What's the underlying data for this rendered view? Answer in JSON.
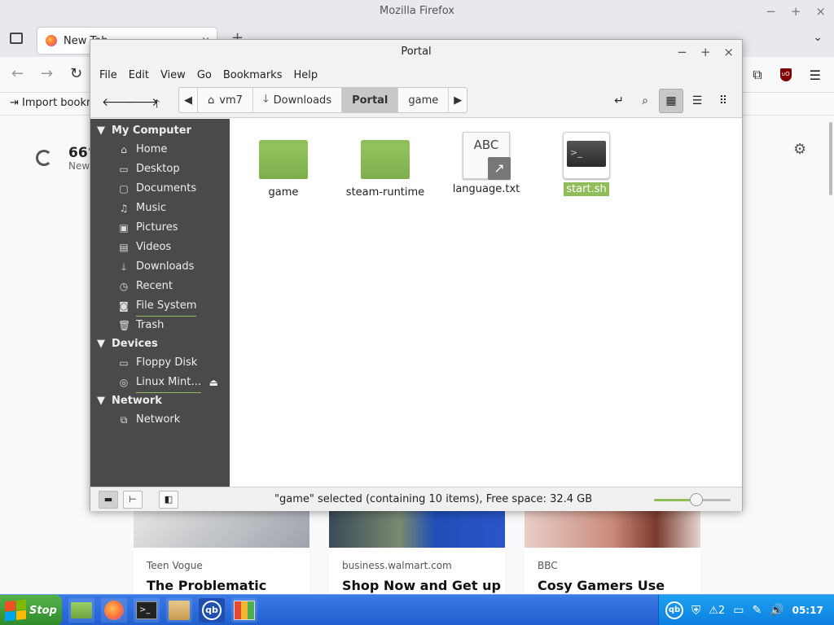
{
  "firefox": {
    "window_title": "Mozilla Firefox",
    "tab_label": "New Tab",
    "bookmark_import": "Import bookm",
    "weather_temp": "66°",
    "weather_sub": "New",
    "cards": [
      {
        "source": "Teen Vogue",
        "title": "The Problematic"
      },
      {
        "source": "business.walmart.com",
        "title": "Shop Now and Get up"
      },
      {
        "source": "BBC",
        "title": "Cosy Gamers Use"
      }
    ]
  },
  "nemo": {
    "title": "Portal",
    "menu": [
      "File",
      "Edit",
      "View",
      "Go",
      "Bookmarks",
      "Help"
    ],
    "breadcrumbs": [
      "vm7",
      "Downloads",
      "Portal",
      "game"
    ],
    "active_crumb": "Portal",
    "sidebar": {
      "sections": [
        {
          "header": "My Computer",
          "items": [
            {
              "label": "Home",
              "icon": "home-icon"
            },
            {
              "label": "Desktop",
              "icon": "desktop-icon"
            },
            {
              "label": "Documents",
              "icon": "documents-icon"
            },
            {
              "label": "Music",
              "icon": "music-icon"
            },
            {
              "label": "Pictures",
              "icon": "pictures-icon"
            },
            {
              "label": "Videos",
              "icon": "videos-icon"
            },
            {
              "label": "Downloads",
              "icon": "downloads-icon"
            },
            {
              "label": "Recent",
              "icon": "recent-icon"
            },
            {
              "label": "File System",
              "icon": "filesystem-icon"
            },
            {
              "label": "Trash",
              "icon": "trash-icon"
            }
          ]
        },
        {
          "header": "Devices",
          "items": [
            {
              "label": "Floppy Disk",
              "icon": "floppy-icon"
            },
            {
              "label": "Linux Mint…",
              "icon": "disc-icon"
            }
          ]
        },
        {
          "header": "Network",
          "items": [
            {
              "label": "Network",
              "icon": "network-icon"
            }
          ]
        }
      ]
    },
    "files": [
      {
        "name": "game",
        "type": "folder"
      },
      {
        "name": "steam-runtime",
        "type": "folder"
      },
      {
        "name": "language.txt",
        "type": "text-link",
        "preview": "ABC"
      },
      {
        "name": "start.sh",
        "type": "script",
        "selected": true
      }
    ],
    "status_text": "\"game\" selected (containing 10 items), Free space: 32.4 GB",
    "zoom_fraction": 0.55
  },
  "taskbar": {
    "start_label": "Stop",
    "tray_badge": "2",
    "clock": "05:17",
    "qb_label": "qb"
  }
}
